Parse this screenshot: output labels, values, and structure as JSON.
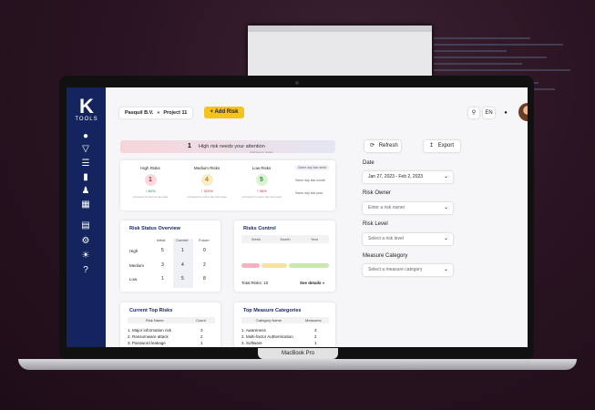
{
  "laptop": {
    "model": "MacBook Pro"
  },
  "app": {
    "logo_text": "TOOLS"
  },
  "header": {
    "company": "Pasquil B.V.",
    "separator": "»",
    "project": "Project 11",
    "add_risk_label": "+ Add Risk",
    "language": "EN"
  },
  "alert": {
    "count": "1",
    "text": "High risk needs your attention",
    "subtext": "click here to review"
  },
  "summary": {
    "high": {
      "label": "High Risks",
      "value": "1",
      "delta": "↓ 80%",
      "caption": "compared to last-ca day-date"
    },
    "medium": {
      "label": "Medium Risks",
      "value": "4",
      "delta": "↑ 322%",
      "caption": "compared to same day last week"
    },
    "low": {
      "label": "Low Risks",
      "value": "5",
      "delta": "↑ 96%",
      "caption": "compared to same day last week"
    },
    "notes": [
      "Same day last week",
      "Same day last month",
      "Same day last year"
    ]
  },
  "status_overview": {
    "title": "Risk Status Overview",
    "columns": [
      "Initial",
      "Current",
      "Future"
    ],
    "rows": [
      {
        "label": "High",
        "values": [
          "5",
          "1",
          "0"
        ]
      },
      {
        "label": "Medium",
        "values": [
          "3",
          "4",
          "2"
        ]
      },
      {
        "label": "Low",
        "values": [
          "1",
          "5",
          "8"
        ]
      }
    ]
  },
  "risks_control": {
    "title": "Risks Control",
    "tabs": [
      "Week",
      "Month",
      "Year"
    ],
    "total_label": "Total Risks: 10",
    "details_label": "See details",
    "details_arrow": "»",
    "bar_colors": [
      "#f2b4bf",
      "#f5e1a6",
      "#c9e7b3"
    ]
  },
  "top_risks": {
    "title": "Current Top Risks",
    "col_name": "Risk Name",
    "col_count": "Count",
    "rows": [
      {
        "name": "1. Major information risk",
        "count": "3"
      },
      {
        "name": "2. Ransomware attack",
        "count": "2"
      },
      {
        "name": "3. Password leakage",
        "count": "1"
      }
    ]
  },
  "top_measures": {
    "title": "Top Measure Categories",
    "col_name": "Category Name",
    "col_count": "Measures",
    "rows": [
      {
        "name": "1. Awareness",
        "count": "3"
      },
      {
        "name": "2. Multi-factor Authentication",
        "count": "2"
      },
      {
        "name": "3. Software",
        "count": "1"
      }
    ]
  },
  "filters": {
    "refresh_label": "Refresh",
    "export_label": "Export",
    "date_label": "Date",
    "date_value": "Jan 27, 2023 - Feb 2, 2023",
    "owner_label": "Risk Owner",
    "owner_placeholder": "Enter a risk owner",
    "level_label": "Risk Level",
    "level_placeholder": "Select a risk level",
    "category_label": "Measure Category",
    "category_placeholder": "Select a measure category"
  }
}
